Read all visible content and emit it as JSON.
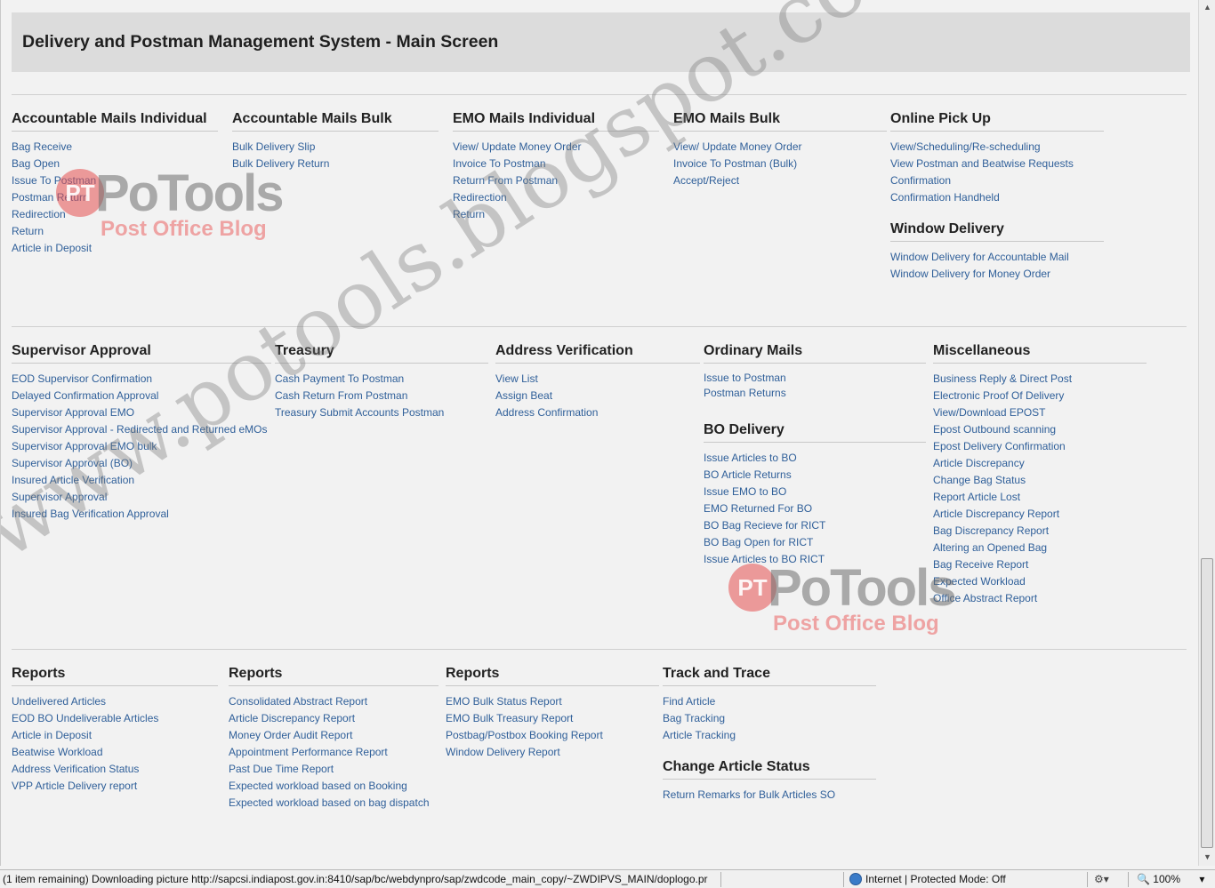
{
  "header": {
    "title": "Delivery and Postman Management System - Main Screen"
  },
  "row1": [
    {
      "title": "Accountable Mails Individual",
      "items": [
        "Bag Receive",
        "Bag Open",
        "Issue To Postman",
        "Postman Return",
        "Redirection",
        "Return",
        "Article in Deposit"
      ]
    },
    {
      "title": "Accountable Mails Bulk",
      "items": [
        "Bulk Delivery Slip",
        "Bulk Delivery Return"
      ]
    },
    {
      "title": "EMO Mails Individual",
      "items": [
        "View/ Update Money Order",
        "Invoice To Postman",
        "Return From Postman",
        "Redirection",
        "Return"
      ]
    },
    {
      "title": "EMO Mails Bulk",
      "items": [
        "View/ Update Money Order",
        "Invoice To Postman (Bulk)",
        "Accept/Reject"
      ]
    },
    {
      "title": "Online Pick Up",
      "items": [
        "View/Scheduling/Re-scheduling",
        "View Postman and Beatwise Requests",
        "Confirmation",
        "Confirmation Handheld"
      ]
    },
    {
      "title": "Window Delivery",
      "items": [
        "Window Delivery for Accountable Mail",
        "Window Delivery for Money Order"
      ]
    }
  ],
  "row2": [
    {
      "title": "Supervisor Approval",
      "items": [
        "EOD Supervisor Confirmation",
        "Delayed Confirmation Approval",
        "Supervisor Approval EMO",
        "Supervisor Approval - Redirected and Returned eMOs",
        "Supervisor Approval EMO bulk",
        "Supervisor Approval (BO)",
        "Insured Article Verification",
        "Supervisor Approval",
        "Insured Bag Verification Approval"
      ]
    },
    {
      "title": "Treasury",
      "items": [
        "Cash Payment To Postman",
        "Cash Return From Postman",
        "Treasury Submit Accounts Postman"
      ]
    },
    {
      "title": "Address Verification",
      "items": [
        "View List",
        "Assign Beat",
        "Address Confirmation"
      ]
    },
    {
      "title": "Ordinary Mails",
      "items": [
        "Issue to Postman",
        "Postman Returns"
      ]
    },
    {
      "title": "BO Delivery",
      "items": [
        "Issue Articles to BO",
        "BO Article Returns",
        "Issue EMO to BO",
        "EMO Returned For BO",
        "BO Bag Recieve for RICT",
        "BO Bag Open for RICT",
        "Issue Articles to BO RICT"
      ]
    },
    {
      "title": "Miscellaneous",
      "items": [
        "Business Reply & Direct Post",
        "Electronic Proof Of Delivery",
        "View/Download EPOST",
        "Epost Outbound scanning",
        "Epost Delivery Confirmation",
        "Article Discrepancy",
        "Change Bag Status",
        "Report Article Lost",
        "Article Discrepancy Report",
        "Bag Discrepancy Report",
        "Altering an Opened Bag",
        "Bag Receive Report",
        "Expected Workload",
        "Office Abstract Report"
      ]
    }
  ],
  "row3": [
    {
      "title": "Reports",
      "items": [
        "Undelivered Articles",
        "EOD BO Undeliverable Articles",
        "Article in Deposit",
        "Beatwise Workload",
        "Address Verification Status",
        "VPP Article Delivery report"
      ]
    },
    {
      "title": "Reports",
      "items": [
        "Consolidated Abstract Report",
        "Article Discrepancy Report",
        "Money Order Audit Report",
        "Appointment Performance Report",
        "Past Due Time Report",
        "Expected workload based on Booking",
        "Expected workload based on bag dispatch"
      ]
    },
    {
      "title": "Reports",
      "items": [
        "EMO Bulk Status Report",
        "EMO Bulk Treasury Report",
        "Postbag/Postbox Booking Report",
        "Window Delivery Report"
      ]
    },
    {
      "title": "Track and Trace",
      "items": [
        "Find Article",
        "Bag Tracking",
        "Article Tracking"
      ]
    },
    {
      "title": "Change Article Status",
      "items": [
        "Return Remarks for Bulk Articles SO"
      ]
    }
  ],
  "watermark": {
    "url_text": "www.potools.blogspot.com",
    "logo_initials": "PT",
    "logo_name": "PoTools",
    "logo_subtitle": "Post Office Blog"
  },
  "statusbar": {
    "message": "(1 item remaining) Downloading picture http://sapcsi.indiapost.gov.in:8410/sap/bc/webdynpro/sap/zwdcode_main_copy/~ZWDIPVS_MAIN/doplogo.pr",
    "zone": "Internet | Protected Mode: Off",
    "zoom": "100%"
  },
  "colors": {
    "link": "#2f5f99",
    "header_bg": "#dcdcdc",
    "page_bg": "#f2f2f2"
  }
}
